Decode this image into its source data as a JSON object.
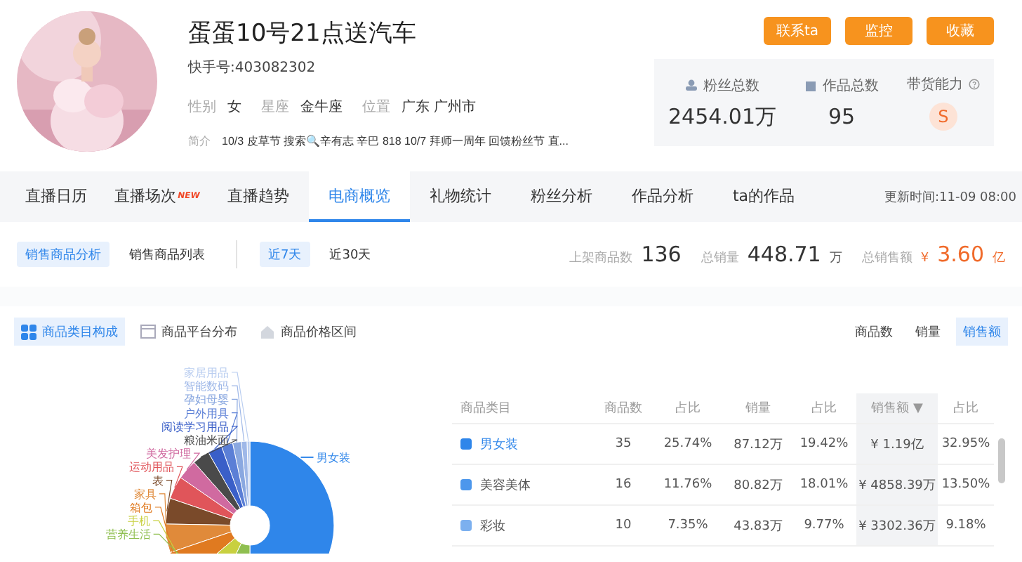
{
  "profile": {
    "name": "蛋蛋10号21点送汽车",
    "account": "快手号:403082302",
    "facts": [
      {
        "label": "性别",
        "value": "女"
      },
      {
        "label": "星座",
        "value": "金牛座"
      },
      {
        "label": "位置",
        "value": "广东 广州市"
      }
    ],
    "bio_label": "简介",
    "bio": "10/3 皮草节 搜索🔍辛有志 辛巴 818 10/7 拜师一周年 回馈粉丝节 直..."
  },
  "actions": [
    "联系ta",
    "监控",
    "收藏"
  ],
  "stats": [
    {
      "kind": "number",
      "label": "粉丝总数",
      "value": "2454.01万"
    },
    {
      "kind": "number",
      "label": "作品总数",
      "value": "95"
    },
    {
      "kind": "grade",
      "label": "带货能力",
      "value": "S"
    }
  ],
  "tabs": [
    {
      "label": "直播日历",
      "selected": false
    },
    {
      "label": "直播场次",
      "badge": "NEW",
      "selected": false
    },
    {
      "label": "直播趋势",
      "selected": false
    },
    {
      "label": "电商概览",
      "selected": true
    },
    {
      "label": "礼物统计",
      "selected": false
    },
    {
      "label": "粉丝分析",
      "selected": false
    },
    {
      "label": "作品分析",
      "selected": false
    },
    {
      "label": "ta的作品",
      "selected": false
    }
  ],
  "updated": "更新时间:11-09 08:00",
  "views": [
    {
      "label": "销售商品分析",
      "selected": true
    },
    {
      "label": "销售商品列表",
      "selected": false
    }
  ],
  "periods": [
    {
      "label": "近7天",
      "selected": true
    },
    {
      "label": "近30天",
      "selected": false
    }
  ],
  "summary": [
    {
      "label": "上架商品数",
      "value": "136",
      "accent": false
    },
    {
      "label": "总销量",
      "value": "448.71",
      "unit": "万",
      "accent": false
    },
    {
      "label": "总销售额",
      "prefix": "¥",
      "value": "3.60",
      "unit": "亿",
      "accent": true
    }
  ],
  "chart_tabs": [
    {
      "label": "商品类目构成",
      "selected": true
    },
    {
      "label": "商品平台分布",
      "selected": false
    },
    {
      "label": "商品价格区间",
      "selected": false
    }
  ],
  "metrics": [
    {
      "label": "商品数",
      "selected": false
    },
    {
      "label": "销量",
      "selected": false
    },
    {
      "label": "销售额",
      "selected": true
    }
  ],
  "donut_labels": [
    {
      "kind": "minor",
      "label": "家居用品",
      "color": "#b9cdf0"
    },
    {
      "kind": "minor",
      "label": "智能数码",
      "color": "#9fb8e8"
    },
    {
      "kind": "minor",
      "label": "孕妇母婴",
      "color": "#8aa8e0"
    },
    {
      "kind": "minor",
      "label": "户外用具",
      "color": "#5b7fd6"
    },
    {
      "kind": "minor",
      "label": "阅读学习用品",
      "color": "#3a5fc8"
    },
    {
      "kind": "minor",
      "label": "粮油米面",
      "color": "#4a4a4a"
    },
    {
      "kind": "minor",
      "label": "美发护理",
      "color": "#d06aa0"
    },
    {
      "kind": "minor",
      "label": "运动用品",
      "color": "#e0555a"
    },
    {
      "kind": "major",
      "label": "男女装",
      "color": "#2f86ea"
    },
    {
      "kind": "minor",
      "label": "表",
      "color": "#7a4a2a"
    },
    {
      "kind": "minor",
      "label": "家具",
      "color": "#e08a3a"
    },
    {
      "kind": "minor",
      "label": "箱包",
      "color": "#e07a20"
    },
    {
      "kind": "minor",
      "label": "手机",
      "color": "#c8d040"
    },
    {
      "kind": "minor",
      "label": "营养生活",
      "color": "#8fbf50"
    }
  ],
  "table": {
    "columns": [
      {
        "label": "商品类目",
        "sorted": false
      },
      {
        "label": "商品数",
        "sorted": false
      },
      {
        "label": "占比",
        "sorted": false
      },
      {
        "label": "销量",
        "sorted": false
      },
      {
        "label": "占比",
        "sorted": false
      },
      {
        "label": "销售额 ▼",
        "sorted": true
      },
      {
        "label": "占比",
        "sorted": false
      }
    ],
    "rows": [
      {
        "color": "#2f86ea",
        "selected": true,
        "cells": [
          "男女装",
          "35",
          "25.74%",
          "87.12万",
          "19.42%",
          "¥ 1.19亿",
          "32.95%"
        ]
      },
      {
        "color": "#4d97ec",
        "selected": false,
        "cells": [
          "美容美体",
          "16",
          "11.76%",
          "80.82万",
          "18.01%",
          "¥ 4858.39万",
          "13.50%"
        ]
      },
      {
        "color": "#7cb0ef",
        "selected": false,
        "cells": [
          "彩妆",
          "10",
          "7.35%",
          "43.83万",
          "9.77%",
          "¥ 3302.36万",
          "9.18%"
        ]
      }
    ]
  }
}
